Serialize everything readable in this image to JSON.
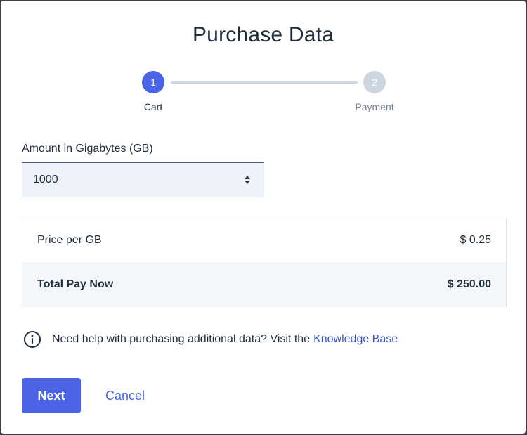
{
  "dialog": {
    "title": "Purchase Data"
  },
  "stepper": {
    "steps": [
      {
        "number": "1",
        "label": "Cart",
        "active": true
      },
      {
        "number": "2",
        "label": "Payment",
        "active": false
      }
    ]
  },
  "amount": {
    "label": "Amount in Gigabytes (GB)",
    "value": "1000"
  },
  "pricing": {
    "price_label": "Price per GB",
    "price_value": "$ 0.25",
    "total_label": "Total Pay Now",
    "total_value": "$ 250.00"
  },
  "help": {
    "text": "Need help with purchasing additional data? Visit the",
    "link_text": "Knowledge Base",
    "icon": "info-circle-icon"
  },
  "actions": {
    "next_label": "Next",
    "cancel_label": "Cancel"
  },
  "colors": {
    "accent": "#4a63e7",
    "step_inactive": "#cdd5e0",
    "text": "#1f2d3d",
    "link": "#3d55c8"
  }
}
